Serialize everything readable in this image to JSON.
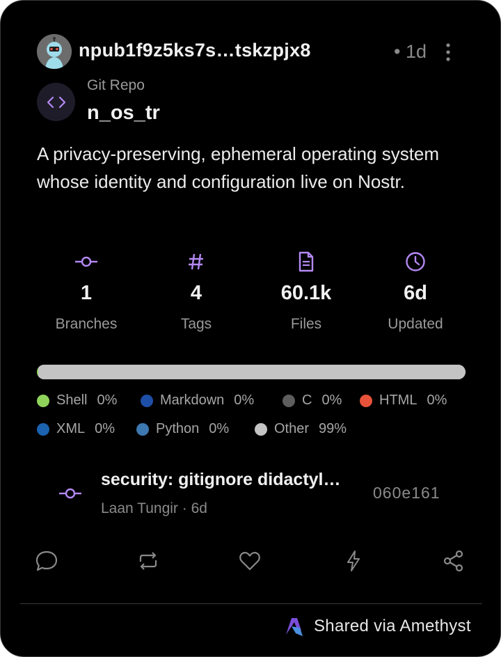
{
  "post": {
    "author": "npub1f9z5ks7s…tskzpjx8",
    "time": "• 1d"
  },
  "repo": {
    "kind": "Git Repo",
    "name": "n_os_tr",
    "description": "A privacy-preserving, ephemeral operating system whose identity and configuration live on Nostr."
  },
  "stats": [
    {
      "icon": "commit-icon",
      "value": "1",
      "label": "Branches"
    },
    {
      "icon": "hash-icon",
      "value": "4",
      "label": "Tags"
    },
    {
      "icon": "file-icon",
      "value": "60.1k",
      "label": "Files"
    },
    {
      "icon": "clock-icon",
      "value": "6d",
      "label": "Updated"
    }
  ],
  "languages": [
    {
      "name": "Shell",
      "pct": "0%",
      "color": "#8fd35a",
      "fraction": 0.004
    },
    {
      "name": "Markdown",
      "pct": "0%",
      "color": "#1e4fa8",
      "fraction": 0.0
    },
    {
      "name": "C",
      "pct": "0%",
      "color": "#5e5e5e",
      "fraction": 0.0
    },
    {
      "name": "HTML",
      "pct": "0%",
      "color": "#e6533a",
      "fraction": 0.0
    },
    {
      "name": "XML",
      "pct": "0%",
      "color": "#1b62b0",
      "fraction": 0.0
    },
    {
      "name": "Python",
      "pct": "0%",
      "color": "#3d78b0",
      "fraction": 0.0
    },
    {
      "name": "Other",
      "pct": "99%",
      "color": "#c4c4c4",
      "fraction": 0.996
    }
  ],
  "commit": {
    "message": "security: gitignore didactyl…",
    "meta": "Laan Tungir · 6d",
    "hash": "060e161"
  },
  "actions": [
    "reply-icon",
    "repost-icon",
    "like-icon",
    "zap-icon",
    "share-icon"
  ],
  "footer": {
    "text": "Shared via Amethyst"
  },
  "colors": {
    "accent": "#b58af5",
    "background": "#000000",
    "muted": "#9a9a9a"
  }
}
